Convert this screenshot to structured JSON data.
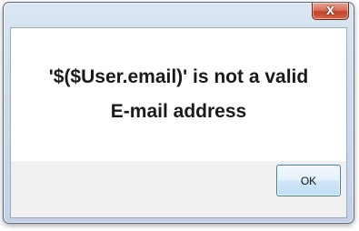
{
  "dialog": {
    "close_label": "X",
    "message": "'$($User.email)' is not a valid E-mail address",
    "ok_label": "OK"
  },
  "colors": {
    "close_button": "#c2432a",
    "frame": "#cfdbea",
    "message_background": "#ffffff"
  },
  "icons": {
    "close": "close-icon"
  }
}
